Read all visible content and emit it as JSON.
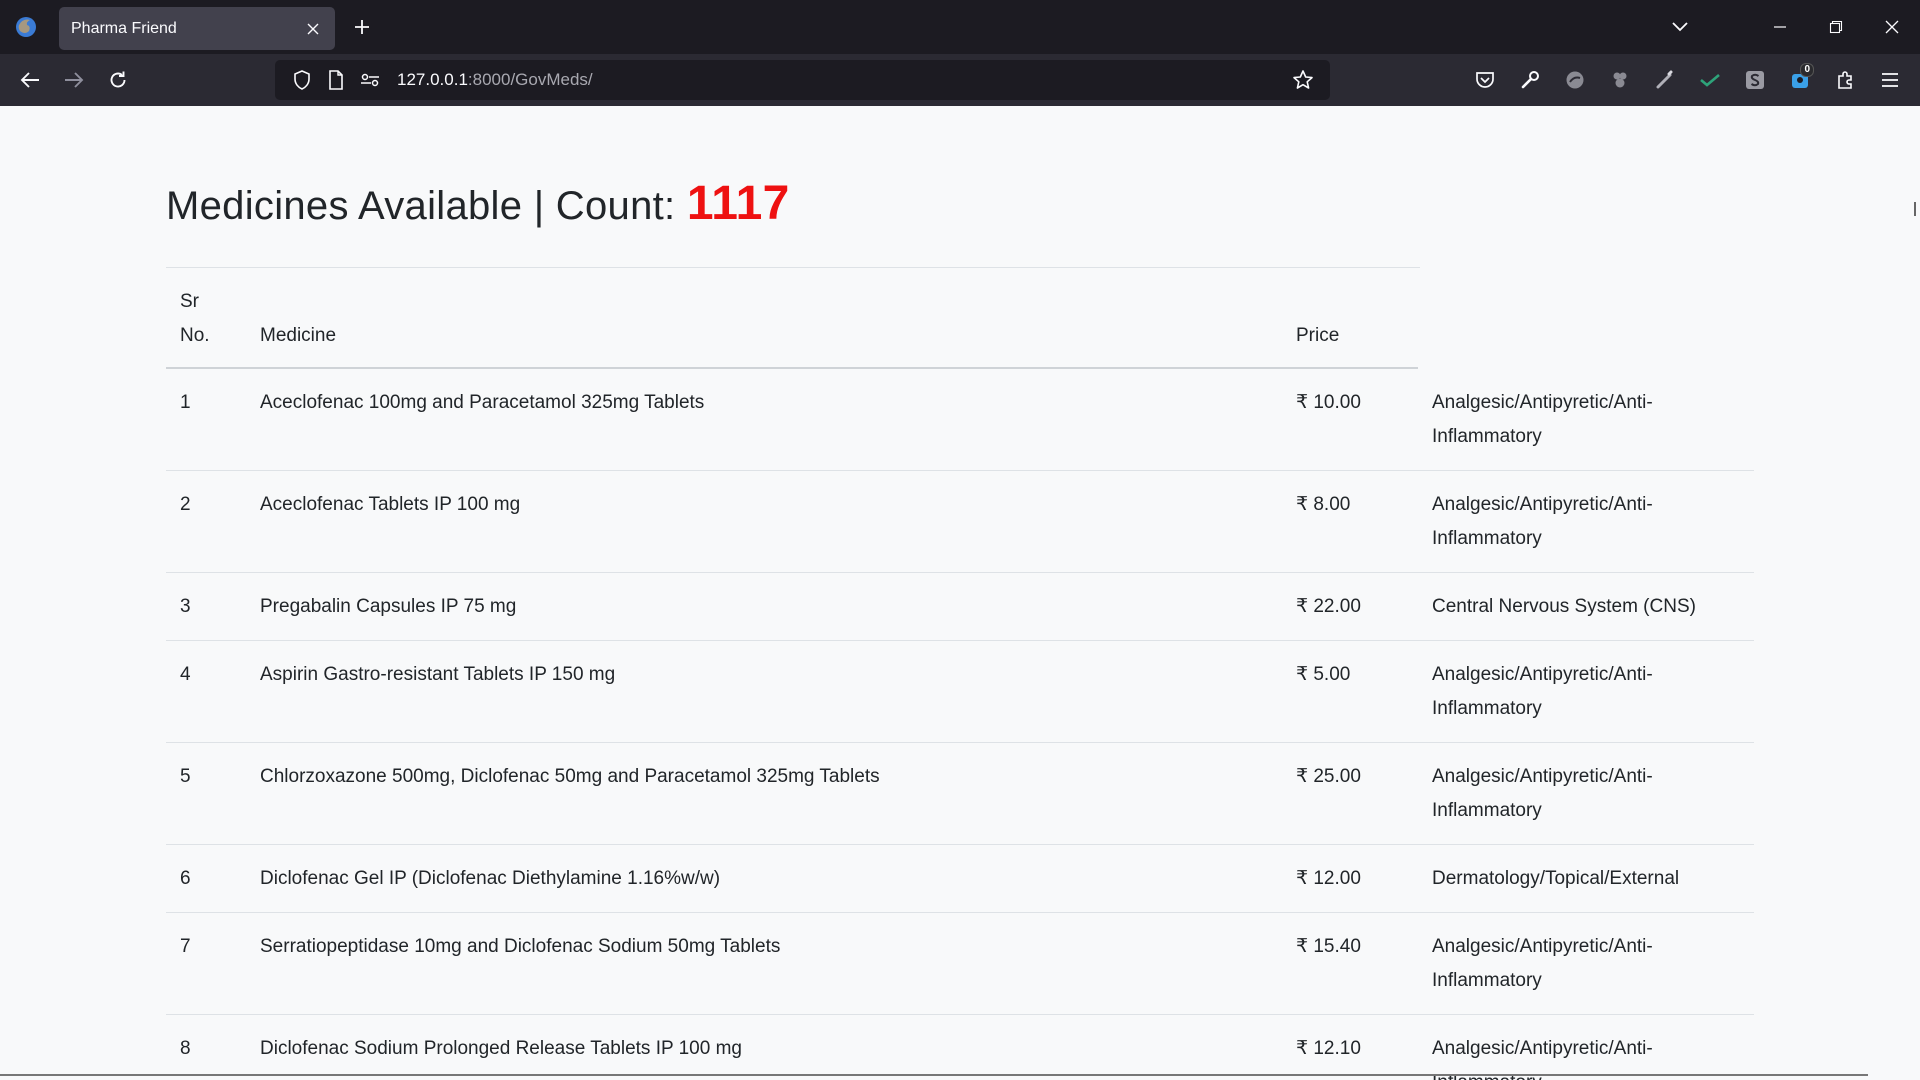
{
  "browser": {
    "tab_title": "Pharma Friend",
    "url_host": "127.0.0.1",
    "url_rest": ":8000/GovMeds/",
    "ext_badge": "0"
  },
  "heading": {
    "text": "Medicines Available | Count: ",
    "count": "1117"
  },
  "table": {
    "headers": {
      "sr": "Sr No.",
      "medicine": "Medicine",
      "price": "Price",
      "category": ""
    },
    "rows": [
      {
        "sr": "1",
        "medicine": "Aceclofenac 100mg and Paracetamol 325mg Tablets",
        "price": "₹ 10.00",
        "category": "Analgesic/Antipyretic/Anti-Inflammatory"
      },
      {
        "sr": "2",
        "medicine": "Aceclofenac Tablets IP 100 mg",
        "price": "₹ 8.00",
        "category": "Analgesic/Antipyretic/Anti-Inflammatory"
      },
      {
        "sr": "3",
        "medicine": "Pregabalin Capsules IP 75 mg",
        "price": "₹ 22.00",
        "category": "Central Nervous System (CNS)"
      },
      {
        "sr": "4",
        "medicine": "Aspirin Gastro-resistant Tablets IP 150 mg",
        "price": "₹ 5.00",
        "category": "Analgesic/Antipyretic/Anti-Inflammatory"
      },
      {
        "sr": "5",
        "medicine": "Chlorzoxazone 500mg, Diclofenac 50mg and Paracetamol 325mg Tablets",
        "price": "₹ 25.00",
        "category": "Analgesic/Antipyretic/Anti-Inflammatory"
      },
      {
        "sr": "6",
        "medicine": "Diclofenac Gel IP (Diclofenac Diethylamine 1.16%w/w)",
        "price": "₹ 12.00",
        "category": "Dermatology/Topical/External"
      },
      {
        "sr": "7",
        "medicine": "Serratiopeptidase 10mg and Diclofenac Sodium 50mg Tablets",
        "price": "₹ 15.40",
        "category": "Analgesic/Antipyretic/Anti-Inflammatory"
      },
      {
        "sr": "8",
        "medicine": "Diclofenac Sodium Prolonged Release Tablets IP 100 mg",
        "price": "₹ 12.10",
        "category": "Analgesic/Antipyretic/Anti-Inflammatory"
      }
    ]
  }
}
